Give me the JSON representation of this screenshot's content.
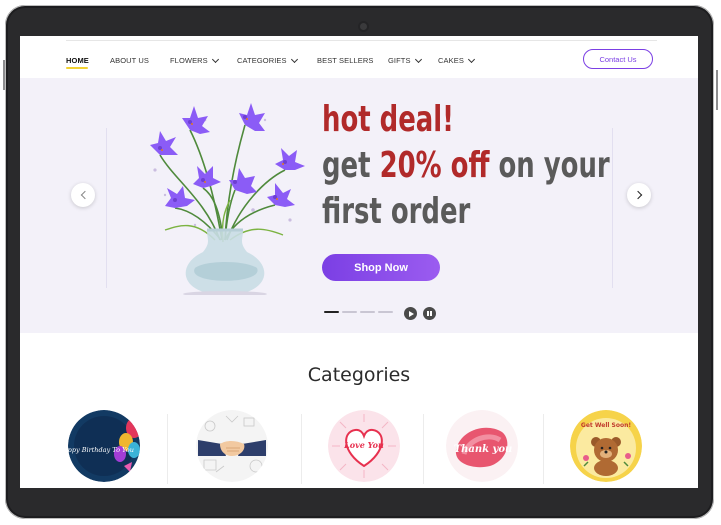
{
  "nav": {
    "items": [
      {
        "label": "HOME",
        "active": true,
        "dropdown": false
      },
      {
        "label": "ABOUT US",
        "active": false,
        "dropdown": false
      },
      {
        "label": "FLOWERS",
        "active": false,
        "dropdown": true
      },
      {
        "label": "CATEGORIES",
        "active": false,
        "dropdown": true
      },
      {
        "label": "BEST SELLERS",
        "active": false,
        "dropdown": false
      },
      {
        "label": "GIFTS",
        "active": false,
        "dropdown": true
      },
      {
        "label": "CAKES",
        "active": false,
        "dropdown": true
      }
    ],
    "contact_label": "Contact Us"
  },
  "hero": {
    "line1": "hot deal!",
    "line2_prefix": "get",
    "line2_highlight": "20% off",
    "line2_suffix": "on your",
    "line3": "first order",
    "cta_label": "Shop Now",
    "slide_count": 4,
    "active_slide": 1
  },
  "categories": {
    "title": "Categories",
    "items": [
      {
        "icon": "birthday-cake-balloons-icon",
        "caption": "Happy Birthday To You"
      },
      {
        "icon": "handshake-icon",
        "caption": ""
      },
      {
        "icon": "love-you-heart-icon",
        "caption": "Love You"
      },
      {
        "icon": "thank-you-icon",
        "caption": "Thank you"
      },
      {
        "icon": "get-well-soon-bear-icon",
        "caption": "Get Well Soon!"
      }
    ]
  },
  "colors": {
    "accent": "#7b3fe4",
    "deal_red": "#b12a2a",
    "hero_bg": "#f3f1f9",
    "active_underline": "#f1d132"
  }
}
